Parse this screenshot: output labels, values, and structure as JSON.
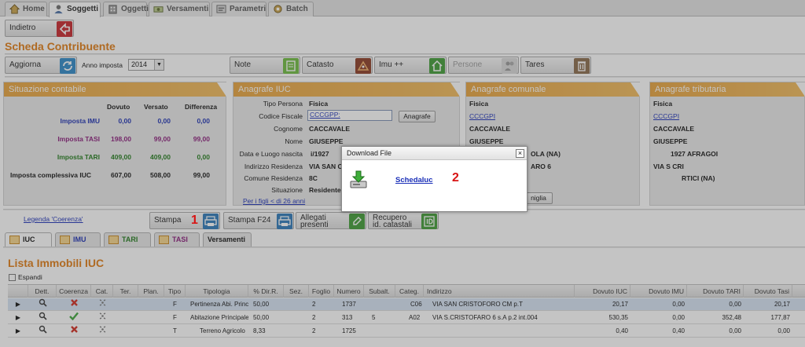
{
  "top_tabs": [
    "Home",
    "Soggetti",
    "Oggetti",
    "Versamenti",
    "Parametri",
    "Batch"
  ],
  "toolbar": {
    "back_label": "Indietro"
  },
  "page_title": "Scheda Contribuente",
  "controls": {
    "aggiorna_label": "Aggiorna",
    "anno_label": "Anno imposta",
    "anno_value": "2014",
    "note_label": "Note",
    "catasto_label": "Catasto",
    "imu_label": "Imu ++",
    "persone_label": "Persone",
    "tares_label": "Tares"
  },
  "situazione": {
    "header": "Situazione contabile",
    "col_dovuto": "Dovuto",
    "col_versato": "Versato",
    "col_differenza": "Differenza",
    "rows": [
      {
        "label": "Imposta IMU",
        "dovuto": "0,00",
        "versato": "0,00",
        "differenza": "0,00"
      },
      {
        "label": "Imposta TASI",
        "dovuto": "198,00",
        "versato": "99,00",
        "differenza": "99,00"
      },
      {
        "label": "Imposta TARI",
        "dovuto": "409,00",
        "versato": "409,00",
        "differenza": "0,00"
      },
      {
        "label": "Imposta complessiva IUC",
        "dovuto": "607,00",
        "versato": "508,00",
        "differenza": "99,00"
      }
    ]
  },
  "anagrafe_iuc": {
    "header": "Anagrafe IUC",
    "tipo_persona_label": "Tipo Persona",
    "tipo_persona_value": "Fisica",
    "cf_label": "Codice Fiscale",
    "cf_value": "CCCGPP:",
    "anagrafe_btn": "Anagrafe",
    "cognome_label": "Cognome",
    "cognome_value": "CACCAVALE",
    "nome_label": "Nome",
    "nome_value": "GIUSEPPE",
    "nascita_label": "Data e Luogo nascita",
    "nascita_value": "i/1927",
    "indirizzo_label": "Indirizzo Residenza",
    "indirizzo_value": "VIA SAN C",
    "comune_label": "Comune Residenza",
    "comune_value": "8C",
    "situazione_label": "Situazione",
    "situazione_value": "Residente",
    "figli_link": "Per i figli < di 26 anni"
  },
  "anagrafe_comunale": {
    "header": "Anagrafe comunale",
    "tipo": "Fisica",
    "cf": "CCCGPI",
    "cognome": "CACCAVALE",
    "nome": "GIUSEPPE",
    "nascita": "OLA (NA)",
    "indirizzo": "ARO 6",
    "famiglia_btn": "niglia"
  },
  "anagrafe_tributaria": {
    "header": "Anagrafe tributaria",
    "tipo": "Fisica",
    "cf": "CCCGPI",
    "cognome": "CACCAVALE",
    "nome": "GIUSEPPE",
    "nascita": "1927 AFRAGOI",
    "indirizzo": "VIA S CRI",
    "comune": "RTICI (NA)"
  },
  "actions": {
    "legenda_link": "Legenda 'Coerenza'",
    "stampa_label": "Stampa",
    "stampa_f24_label": "Stampa F24",
    "allegati_label_1": "Allegati",
    "allegati_label_2": "presenti",
    "recupero_label_1": "Recupero",
    "recupero_label_2": "id. catastali"
  },
  "lower_tabs": [
    "IUC",
    "IMU",
    "TARI",
    "TASI",
    "Versamenti"
  ],
  "lista": {
    "title": "Lista Immobili IUC",
    "espandi_label": "Espandi",
    "columns": [
      "Dett.",
      "Coerenza",
      "Cat.",
      "Ter.",
      "Plan.",
      "Tipo",
      "Tipologia",
      "% Dir.R.",
      "Sez.",
      "Foglio",
      "Numero",
      "Subalt.",
      "Categ.",
      "Indirizzo",
      "Dovuto IUC",
      "Dovuto IMU",
      "Dovuto TARI",
      "Dovuto Tasi"
    ],
    "rows": [
      {
        "coerenza": "error",
        "tipo": "F",
        "tipologia": "Pertinenza Abi. Princ",
        "dir": "50,00",
        "sez": "",
        "foglio": "2",
        "numero": "1737",
        "subalt": "",
        "categ": "C06",
        "indirizzo": "VIA SAN CRISTOFORO CM p.T",
        "iuc": "20,17",
        "imu": "0,00",
        "tari": "0,00",
        "tasi": "20,17"
      },
      {
        "coerenza": "ok",
        "tipo": "F",
        "tipologia": "Abitazione Principale",
        "dir": "50,00",
        "sez": "",
        "foglio": "2",
        "numero": "313",
        "subalt": "5",
        "categ": "A02",
        "indirizzo": "VIA S.CRISTOFARO 6 s.A p.2 int.004",
        "iuc": "530,35",
        "imu": "0,00",
        "tari": "352,48",
        "tasi": "177,87"
      },
      {
        "coerenza": "error",
        "tipo": "T",
        "tipologia": "Terreno Agricolo",
        "dir": "8,33",
        "sez": "",
        "foglio": "2",
        "numero": "1725",
        "subalt": "",
        "categ": "",
        "indirizzo": "",
        "iuc": "0,40",
        "imu": "0,40",
        "tari": "0,00",
        "tasi": "0,00"
      }
    ]
  },
  "dialog": {
    "title": "Download File",
    "link": "SchedaIuc",
    "close": "×"
  },
  "markers": [
    "1",
    "2"
  ],
  "colors": {
    "accent": "#e07b12",
    "header_orange": "#e8a33c",
    "imu": "#1b2fb3",
    "tasi": "#8a1a7a",
    "tari": "#1e7a18",
    "error_red": "#d22a1e",
    "ok_green": "#3ca53a"
  }
}
